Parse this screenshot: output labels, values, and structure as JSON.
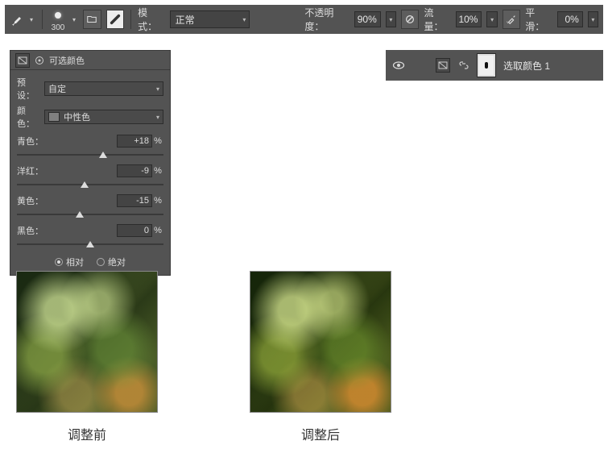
{
  "toolbar": {
    "brush_size": "300",
    "mode_label": "模式：",
    "mode_value": "正常",
    "opacity_label": "不透明度：",
    "opacity_value": "90%",
    "flow_label": "流量：",
    "flow_value": "10%",
    "smoothing_label": "平滑：",
    "smoothing_value": "0%"
  },
  "layer": {
    "name": "选取颜色 1"
  },
  "panel": {
    "title": "可选颜色",
    "preset_label": "预设：",
    "preset_value": "自定",
    "colors_label": "颜色：",
    "colors_value": "中性色",
    "sliders": [
      {
        "name": "青色：",
        "value": "+18",
        "pos": 59
      },
      {
        "name": "洋红：",
        "value": "-9",
        "pos": 46
      },
      {
        "name": "黄色：",
        "value": "-15",
        "pos": 43
      },
      {
        "name": "黑色：",
        "value": "0",
        "pos": 50
      }
    ],
    "method_relative": "相对",
    "method_absolute": "绝对"
  },
  "captions": {
    "before": "调整前",
    "after": "调整后"
  }
}
